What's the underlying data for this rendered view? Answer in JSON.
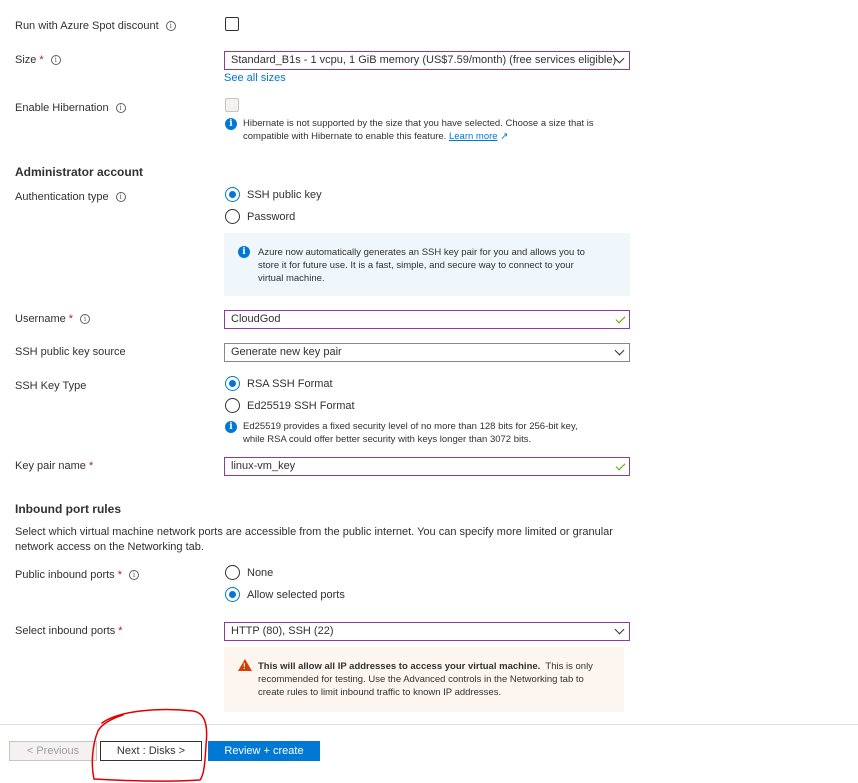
{
  "spot": {
    "label": "Run with Azure Spot discount"
  },
  "size": {
    "label": "Size",
    "required": "*",
    "value": "Standard_B1s - 1 vcpu, 1 GiB memory (US$7.59/month)  (free services eligible)",
    "see_all": "See all sizes"
  },
  "hibernation": {
    "label": "Enable Hibernation",
    "note_line1": "Hibernate is not supported by the size that you have selected. Choose a size that is",
    "note_line2": "compatible with Hibernate to enable this feature.",
    "learn_more": "Learn more"
  },
  "admin": {
    "title": "Administrator account",
    "auth_label": "Authentication type",
    "auth_options": [
      "SSH public key",
      "Password"
    ],
    "info_line1": "Azure now automatically generates an SSH key pair for you and allows you to",
    "info_line2": "store it for future use. It is a fast, simple, and secure way to connect to your",
    "info_line3": "virtual machine.",
    "username_label": "Username",
    "username_required": "*",
    "username_value": "CloudGod",
    "key_source_label": "SSH public key source",
    "key_source_value": "Generate new key pair",
    "key_type_label": "SSH Key Type",
    "key_type_options": [
      "RSA SSH Format",
      "Ed25519 SSH Format"
    ],
    "key_type_note1": "Ed25519 provides a fixed security level of no more than 128 bits for 256-bit key,",
    "key_type_note2": "while RSA could offer better security with keys longer than 3072 bits.",
    "key_name_label": "Key pair name",
    "key_name_required": "*",
    "key_name_value": "linux-vm_key"
  },
  "inbound": {
    "title": "Inbound port rules",
    "desc_line1": "Select which virtual machine network ports are accessible from the public internet. You can specify more limited or granular",
    "desc_line2": "network access on the Networking tab.",
    "public_label": "Public inbound ports",
    "public_required": "*",
    "public_options": [
      "None",
      "Allow selected ports"
    ],
    "select_label": "Select inbound ports",
    "select_required": "*",
    "select_value": "HTTP (80), SSH (22)",
    "warn_bold": "This will allow all IP addresses to access your virtual machine.",
    "warn_rest1": "This is only",
    "warn_line2": "recommended for testing.  Use the Advanced controls in the Networking tab to",
    "warn_line3": "create rules to limit inbound traffic to known IP addresses."
  },
  "footer": {
    "previous": "< Previous",
    "next": "Next : Disks >",
    "review": "Review + create"
  },
  "colors": {
    "accent": "#0078d4",
    "focus_border": "#8a3d9e",
    "annotation": "#e00000"
  }
}
